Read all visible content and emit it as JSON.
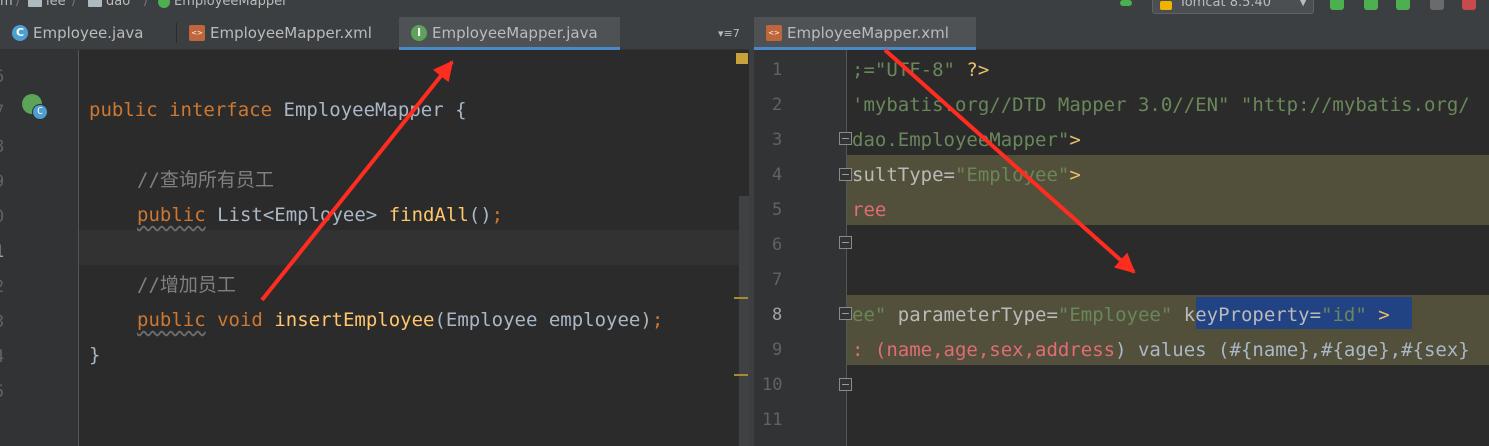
{
  "breadcrumb": {
    "item1": "m",
    "item2": "lee",
    "item3": "dao",
    "item4": "EmployeeMapper"
  },
  "run_config": {
    "label": "Tomcat 8.5.40"
  },
  "left_tabs": [
    {
      "label": "Employee.java",
      "icon": "class-icon",
      "active": false
    },
    {
      "label": "EmployeeMapper.xml",
      "icon": "xml-file-icon",
      "active": false
    },
    {
      "label": "EmployeeMapper.java",
      "icon": "interface-icon",
      "active": true
    }
  ],
  "left_tab_overflow": "▾≡7",
  "right_tabs": [
    {
      "label": "EmployeeMapper.xml",
      "icon": "xml-file-icon",
      "active": true
    }
  ],
  "left_editor": {
    "line_numbers": [
      "6",
      "7",
      "8",
      "9",
      "0",
      "1",
      "2",
      "3",
      "4",
      "5"
    ],
    "code": {
      "l7_kw1": "public",
      "l7_kw2": "interface",
      "l7_name": "EmployeeMapper",
      "l7_brace": "{",
      "l9_comment": "//查询所有员工",
      "l10_kw": "public",
      "l10_type": "List<Employee>",
      "l10_fn": "findAll",
      "l10_paren": "()",
      "l10_semi": ";",
      "l12_comment": "//增加员工",
      "l13_kw1": "public",
      "l13_kw2": "void",
      "l13_fn": "insertEmployee",
      "l13_args": "(Employee employee)",
      "l13_semi": ";",
      "l14_brace": "}"
    }
  },
  "right_editor": {
    "line_numbers": [
      "1",
      "2",
      "3",
      "4",
      "5",
      "6",
      "7",
      "8",
      "9",
      "10",
      "11"
    ],
    "code": {
      "l1_a": ";=",
      "l1_str": "\"UTF-8\"",
      "l1_b": " ?>",
      "l2_str": "'mybatis.org//DTD Mapper 3.0//EN\" \"http://mybatis.org/",
      "l3_str": "dao.EmployeeMapper\"",
      "l3_b": ">",
      "l4_attr": "sultType=",
      "l4_str": "\"Employee\"",
      "l4_b": ">",
      "l5_txt": "ree",
      "l8_str1": "ee\"",
      "l8_attr": " parameterType=",
      "l8_str2": "\"Employee\"",
      "l8_sel_attr": " keyProperty=",
      "l8_sel_str": "\"id\"",
      "l8_b": " >",
      "l9_a": ": (",
      "l9_cols": "name,age,sex,address",
      "l9_b": ") values (",
      "l9_vals": "#{name},#{age},#{sex}"
    }
  },
  "colors": {
    "keyword": "#cc7832",
    "function": "#ffc66d",
    "string": "#6a8759",
    "comment": "#808080",
    "annotation_arrow": "#ff2d20"
  }
}
